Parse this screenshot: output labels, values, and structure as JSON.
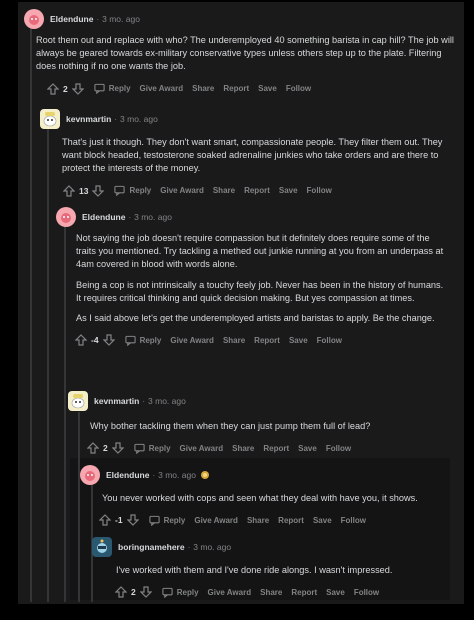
{
  "comments": [
    {
      "author": "Eldendune",
      "time": "3 mo. ago",
      "paragraphs": [
        "Root them out and replace with who? The underemployed 40 something barista in cap hill? The job will always be geared towards ex-military conservative types unless others step up to the plate. Filtering does nothing if no one wants the job."
      ],
      "votes": "2"
    },
    {
      "author": "kevnmartin",
      "time": "3 mo. ago",
      "paragraphs": [
        "That's just it though. They don't want smart, compassionate people. They filter them out. They want block headed, testosterone soaked adrenaline junkies who take orders and are there to protect the interests of the money."
      ],
      "votes": "13"
    },
    {
      "author": "Eldendune",
      "time": "3 mo. ago",
      "paragraphs": [
        "Not saying the job doesn't require compassion but it definitely does require some of the traits you mentioned. Try tackling a methed out junkie running at you from an underpass at 4am covered in blood with words alone.",
        "Being a cop is not intrinsically a touchy feely job. Never has been in the history of humans. It requires critical thinking and quick decision making. But yes compassion at times.",
        "As I said above let's get the underemployed artists and baristas to apply. Be the change."
      ],
      "votes": "-4"
    },
    {
      "author": "kevnmartin",
      "time": "3 mo. ago",
      "paragraphs": [
        "Why bother tackling them when they can just pump them full of lead?"
      ],
      "votes": "2"
    },
    {
      "author": "Eldendune",
      "time": "3 mo. ago",
      "paragraphs": [
        "You never worked with cops and seen what they deal with have you, it shows."
      ],
      "votes": "-1"
    },
    {
      "author": "boringnamehere",
      "time": "3 mo. ago",
      "paragraphs": [
        "I've worked with them and I've done ride alongs. I wasn't impressed."
      ],
      "votes": "2"
    }
  ],
  "actions": {
    "reply": "Reply",
    "give_award": "Give Award",
    "share": "Share",
    "report": "Report",
    "save": "Save",
    "follow": "Follow"
  },
  "dot": "·",
  "colors": {
    "background": "#000000",
    "panel": "#1a1a1b",
    "text": "#d7dadc",
    "meta": "#818384",
    "thread_line": "#343536"
  }
}
